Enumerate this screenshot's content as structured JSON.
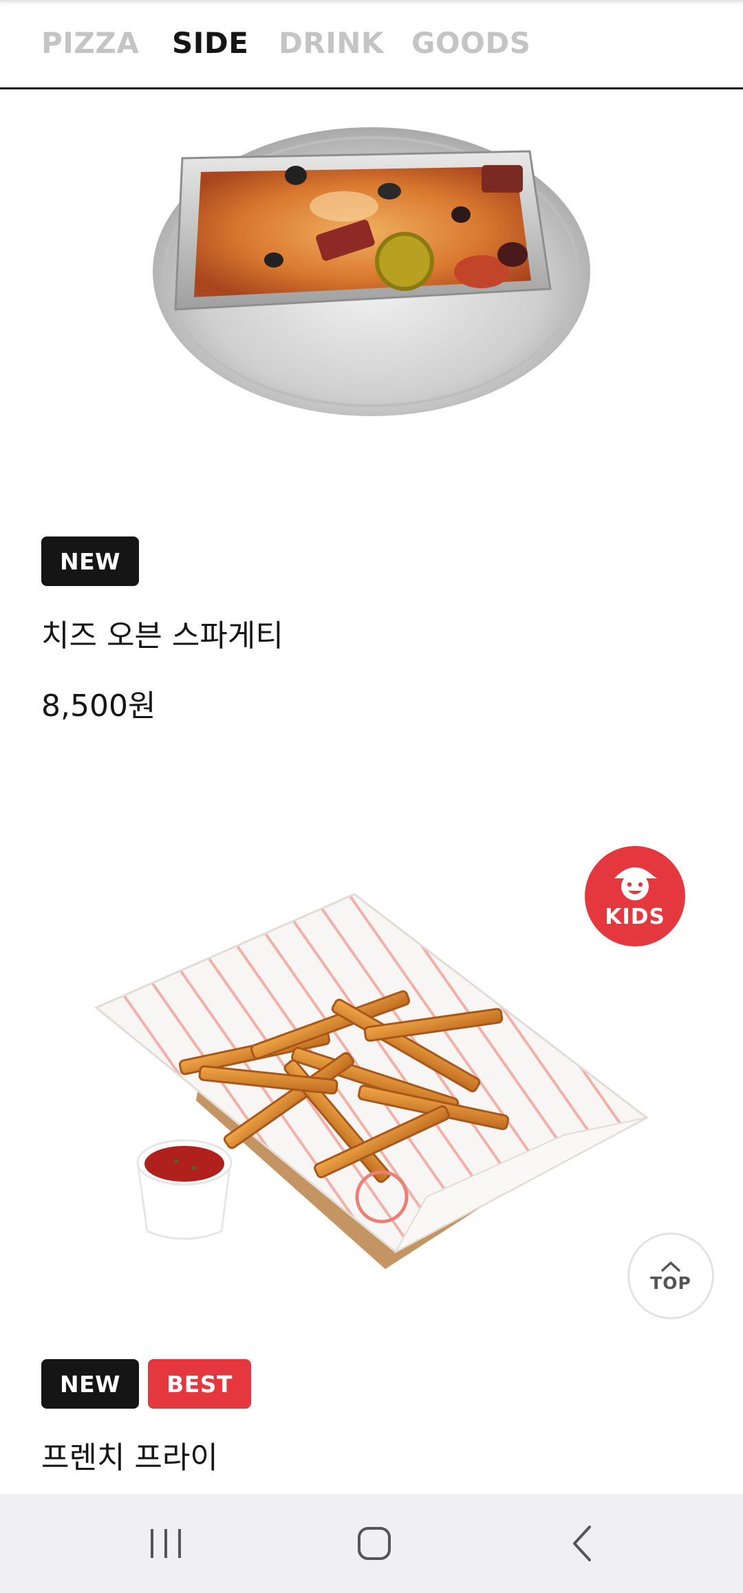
{
  "tabs": [
    {
      "label": "PIZZA",
      "active": false
    },
    {
      "label": "SIDE",
      "active": true
    },
    {
      "label": "DRINK",
      "active": false
    },
    {
      "label": "GOODS",
      "active": false
    }
  ],
  "products": [
    {
      "image": "cheese-oven-spaghetti-photo",
      "badges": [
        "NEW"
      ],
      "name": "치즈 오븐 스파게티",
      "price": "8,500원"
    },
    {
      "image": "french-fries-photo",
      "badges": [
        "NEW",
        "BEST"
      ],
      "name": "프렌치 프라이"
    }
  ],
  "floating": {
    "kids_label": "KIDS",
    "top_label": "TOP"
  },
  "colors": {
    "accent_red": "#e5383e",
    "badge_black": "#151515",
    "inactive_tab": "#c4c4c4"
  },
  "system_nav": [
    "recents-icon",
    "home-icon",
    "back-icon"
  ]
}
